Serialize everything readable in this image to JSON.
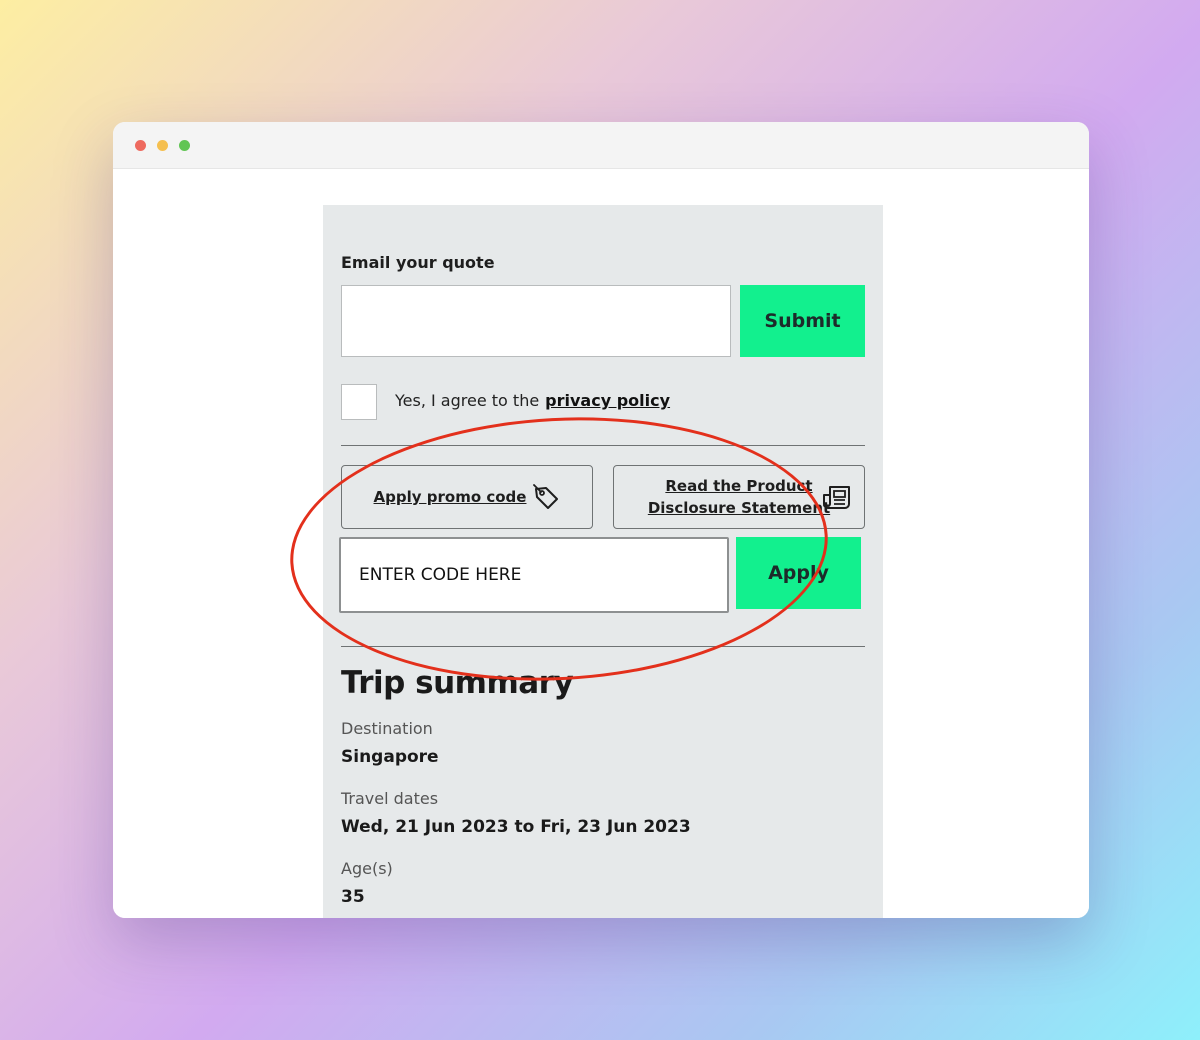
{
  "form": {
    "email_label": "Email your quote",
    "email_value": "",
    "submit_label": "Submit",
    "agree_text": "Yes, I agree to the",
    "privacy_link": "privacy policy"
  },
  "actions": {
    "promo_label": "Apply promo code",
    "pds_line1": "Read the Product",
    "pds_line2": "Disclosure Statement"
  },
  "promo": {
    "input_value": "ENTER CODE HERE",
    "apply_label": "Apply"
  },
  "trip": {
    "title": "Trip summary",
    "destination_label": "Destination",
    "destination_value": "Singapore",
    "dates_label": "Travel dates",
    "dates_value": "Wed, 21 Jun 2023 to Fri, 23 Jun 2023",
    "ages_label": "Age(s)",
    "ages_value": "35"
  },
  "icons": {
    "promo": "price-tag-icon",
    "pds": "document-icon"
  },
  "colors": {
    "accent_green": "#12f08e",
    "annotation_red": "#e3301c",
    "panel_bg": "#e6e9ea"
  }
}
